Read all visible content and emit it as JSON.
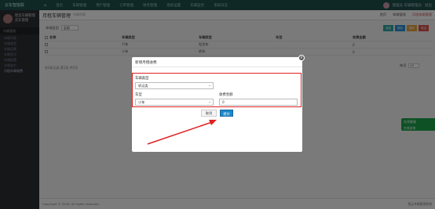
{
  "topbar": {
    "brand": "云车智能联",
    "nav": [
      "首页",
      "车辆管理",
      "用户管理",
      "订单管理",
      "财务管理",
      "系统设置",
      "车辆监控",
      "系统日志"
    ],
    "user": "管理员 车辆管理员",
    "right_link": "退出"
  },
  "sidebar": {
    "profile_name": "智云车辆管理",
    "profile_sub": "云车管理",
    "section": "车辆管理",
    "items": [
      "车辆列表",
      "车辆类型",
      "车辆品牌",
      "车辆型号",
      "车辆配置",
      "车辆定价",
      "月租车辆收费"
    ]
  },
  "main": {
    "title": "月租车辆管理",
    "subtitle": "车辆列表",
    "links": [
      "首页",
      "车辆管理",
      "月租车辆管理"
    ]
  },
  "filter": {
    "label": "车辆类型",
    "select_value": "全部"
  },
  "toolbar": {
    "buttons": [
      {
        "label": "添加",
        "color": "#2fa4a0"
      },
      {
        "label": "修改",
        "color": "#2a8fd6"
      },
      {
        "label": "删除",
        "color": "#e6a23c"
      },
      {
        "label": "导出",
        "color": "#d9534f"
      }
    ]
  },
  "table": {
    "headers": [
      "名称",
      "车辆类型",
      "车辆类型",
      "车型",
      "收费金额"
    ],
    "rows": [
      [
        "",
        "汽车",
        "轻型车",
        "",
        "0"
      ],
      [
        "",
        "小车",
        "轿车",
        "",
        "0"
      ]
    ],
    "pageinfo": "共2条记录 第1页 共1页",
    "perpage_label": "每页",
    "perpage_value": "10"
  },
  "footer": {
    "copyright": "Copyright © 2018, All rights reserved.",
    "right": "智云车辆管理系统"
  },
  "widget": {
    "title": "在线客服",
    "sub": "在线咨询"
  },
  "modal": {
    "title": "新增月租收费",
    "close": "×",
    "field_type_label": "车辆类型",
    "field_type_value": "轿运类",
    "field_model_label": "车型",
    "field_model_value": "小车",
    "field_fee_label": "收费金额",
    "field_fee_value": "0",
    "cancel_label": "取消",
    "submit_label": "提交"
  },
  "colors": {
    "topbar": "#1f4e4a",
    "sidebar": "#2b2f33",
    "submit": "#1e88c9",
    "annotation": "#e02020",
    "widget": "#1aa34a"
  }
}
